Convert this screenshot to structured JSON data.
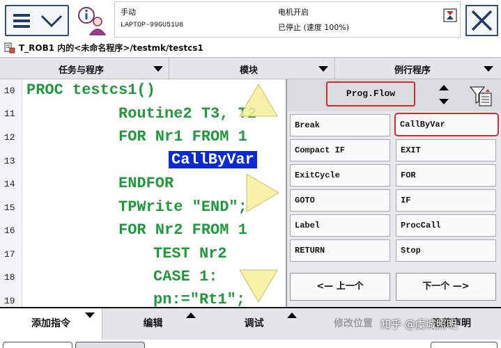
{
  "status": {
    "mode": "手动",
    "controller": "LAPTOP-99GU51U8",
    "motors": "电机开启",
    "state": "已停止 (速度 100%)"
  },
  "breadcrumb": "T_ROB1 内的<未命名程序>/testmk/testcs1",
  "tabs": [
    {
      "label": "任务与程序"
    },
    {
      "label": "模块"
    },
    {
      "label": "例行程序"
    }
  ],
  "line_numbers": [
    "10",
    "11",
    "12",
    "13",
    "14",
    "15",
    "16",
    "17",
    "18",
    "19"
  ],
  "code_lines": [
    "PROC testcs1()",
    "Routine2 T3, T2",
    "FOR Nr1 FROM 1",
    "CallByVar",
    "ENDFOR",
    "TPWrite \"END\";",
    "FOR Nr2 FROM 1",
    "TEST Nr2",
    "CASE 1:",
    "pn:=\"Rt1\";"
  ],
  "panel": {
    "category": "Prog.Flow",
    "instructions": [
      "Break",
      "CallByVar",
      "Compact IF",
      "EXIT",
      "ExitCycle",
      "FOR",
      "GOTO",
      "IF",
      "Label",
      "ProcCall",
      "RETURN",
      "Stop"
    ],
    "selected": "CallByVar",
    "prev": "<— 上一个",
    "next": "下一个 —>"
  },
  "bottom": {
    "add_instruction": "添加指令",
    "edit": "编辑",
    "debug": "调试",
    "modify_position": "修改位置",
    "hide_declarations": "隐藏声明"
  },
  "watermark": "知乎 @虞城照明",
  "colors": {
    "code_green": "#1e9a3a",
    "highlight_blue": "#0a29d8",
    "selection_red": "#d62a2a",
    "frame_blue": "#2e4f7a"
  }
}
